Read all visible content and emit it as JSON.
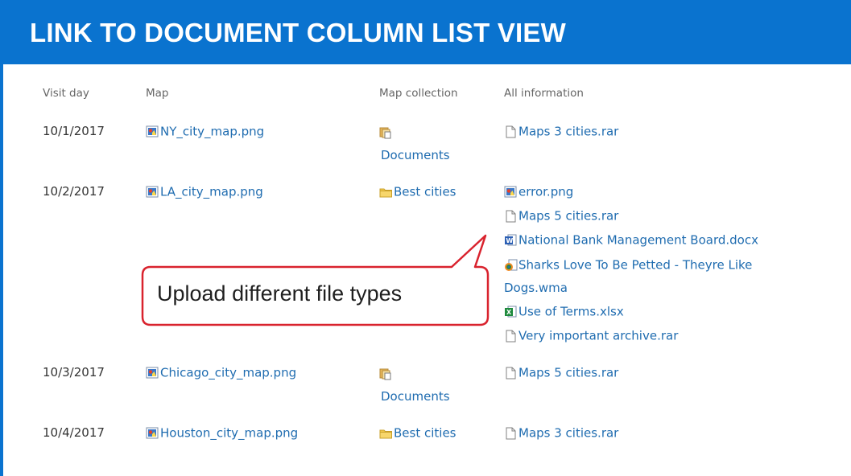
{
  "header": {
    "title": "LINK TO DOCUMENT COLUMN LIST VIEW"
  },
  "columns": {
    "visit_day": "Visit day",
    "map": "Map",
    "map_collection": "Map collection",
    "all_information": "All information"
  },
  "rows": [
    {
      "date": "10/1/2017",
      "map": {
        "name": "NY_city_map.png",
        "icon": "image-file-icon"
      },
      "collection": {
        "name": "Documents",
        "icon": "document-library-icon"
      },
      "info": [
        {
          "name": "Maps 3 cities.rar",
          "icon": "generic-file-icon"
        }
      ]
    },
    {
      "date": "10/2/2017",
      "map": {
        "name": "LA_city_map.png",
        "icon": "image-file-icon"
      },
      "collection": {
        "name": "Best cities",
        "icon": "folder-icon"
      },
      "info": [
        {
          "name": "error.png",
          "icon": "image-file-icon"
        },
        {
          "name": "Maps 5 cities.rar",
          "icon": "generic-file-icon"
        },
        {
          "name": "National Bank Management Board.docx",
          "icon": "word-file-icon"
        },
        {
          "name": "Sharks Love To Be Petted - Theyre Like",
          "name_cont": "Dogs.wma",
          "icon": "media-file-icon"
        },
        {
          "name": "Use of Terms.xlsx",
          "icon": "excel-file-icon"
        },
        {
          "name": "Very important archive.rar",
          "icon": "generic-file-icon"
        }
      ]
    },
    {
      "date": "10/3/2017",
      "map": {
        "name": "Chicago_city_map.png",
        "icon": "image-file-icon"
      },
      "collection": {
        "name": "Documents",
        "icon": "document-library-icon"
      },
      "info": [
        {
          "name": "Maps 5 cities.rar",
          "icon": "generic-file-icon"
        }
      ]
    },
    {
      "date": "10/4/2017",
      "map": {
        "name": "Houston_city_map.png",
        "icon": "image-file-icon"
      },
      "collection": {
        "name": "Best cities",
        "icon": "folder-icon"
      },
      "info": [
        {
          "name": "Maps 3 cities.rar",
          "icon": "generic-file-icon"
        }
      ]
    }
  ],
  "callout": {
    "text": "Upload different file types"
  },
  "colors": {
    "header_bg": "#0a73cf",
    "link": "#1f6cb0",
    "callout_border": "#d9232e"
  }
}
